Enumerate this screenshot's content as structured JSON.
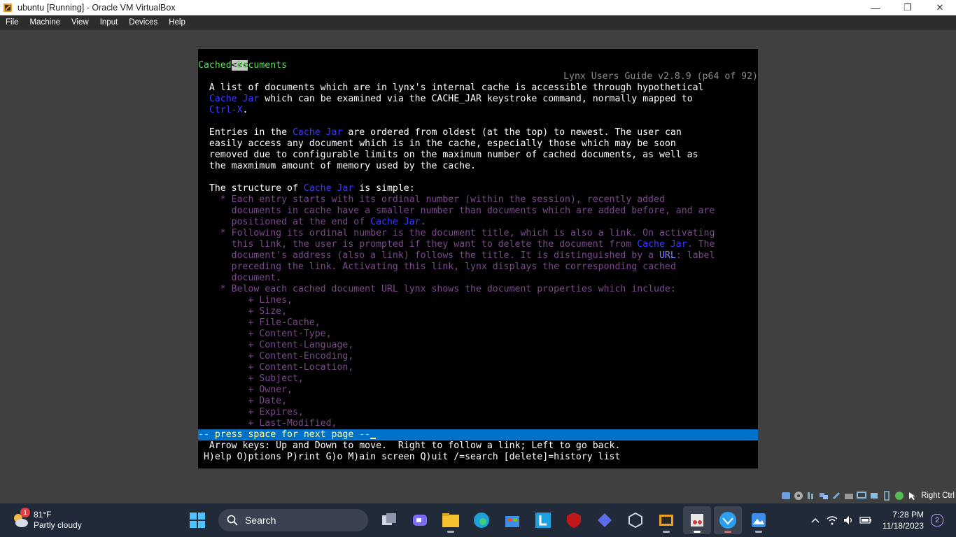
{
  "window": {
    "title": "ubuntu [Running] - Oracle VM VirtualBox",
    "minimize": "—",
    "restore": "❐",
    "close": "✕"
  },
  "menu": [
    "File",
    "Machine",
    "View",
    "Input",
    "Devices",
    "Help"
  ],
  "lynx": {
    "back_arrows": "<<<",
    "header_right": "Lynx Users Guide v2.8.9 (p64 of 92)",
    "section_title": "Cached Documents",
    "cache_jar": "Cache Jar",
    "url_label": "URL",
    "para1_a": "  A list of documents which are in lynx's internal cache is accessible through hypothetical",
    "para1_b": " which can be examined via the CACHE_JAR keystroke command, normally mapped to",
    "ctrl_x": "Ctrl-X",
    "para1_c": ".",
    "para2_a": "  Entries in the ",
    "para2_b": " are ordered from oldest (at the top) to newest. The user can",
    "para2_c": "  easily access any document which is in the cache, especially those which may be soon",
    "para2_d": "  removed due to configurable limits on the maximum number of cached documents, as well as",
    "para2_e": "  the maxmimum amount of memory used by the cache.",
    "struct_a": "  The structure of ",
    "struct_b": " is simple:",
    "b1_a": "    * Each entry starts with its ordinal number (within the session), recently added",
    "b1_b": "      documents in cache have a smaller number than documents which are added before, and are",
    "b1_c": "      positioned at the end of ",
    "b1_d": ".",
    "b2_a": "    * Following its ordinal number is the document title, which is also a link. On activating",
    "b2_b": "      this link, the user is prompted if they want to delete the document from ",
    "b2_c": ". The",
    "b2_d": "      document's address (also a link) follows the title. It is distinguished by a ",
    "b2_e": ": label",
    "b2_f": "      preceding the link. Activating this link, lynx displays the corresponding cached",
    "b2_g": "      document.",
    "b3": "    * Below each cached document URL lynx shows the document properties which include:",
    "props": [
      "         + Lines,",
      "         + Size,",
      "         + File-Cache,",
      "         + Content-Type,",
      "         + Content-Language,",
      "         + Content-Encoding,",
      "         + Content-Location,",
      "         + Subject,",
      "         + Owner,",
      "         + Date,",
      "         + Expires,",
      "         + Last-Modified,"
    ],
    "status_prompt": "-- press space for next page --",
    "help1": "  Arrow keys: Up and Down to move.  Right to follow a link; Left to go back.",
    "help2": " H)elp O)ptions P)rint G)o M)ain screen Q)uit /=search [delete]=history list"
  },
  "vm_status": {
    "host_key": "Right Ctrl"
  },
  "taskbar": {
    "weather_temp": "81°F",
    "weather_desc": "Partly cloudy",
    "weather_badge": "1",
    "search_label": "Search",
    "time": "7:28 PM",
    "date": "11/18/2023",
    "notifications": "2"
  }
}
